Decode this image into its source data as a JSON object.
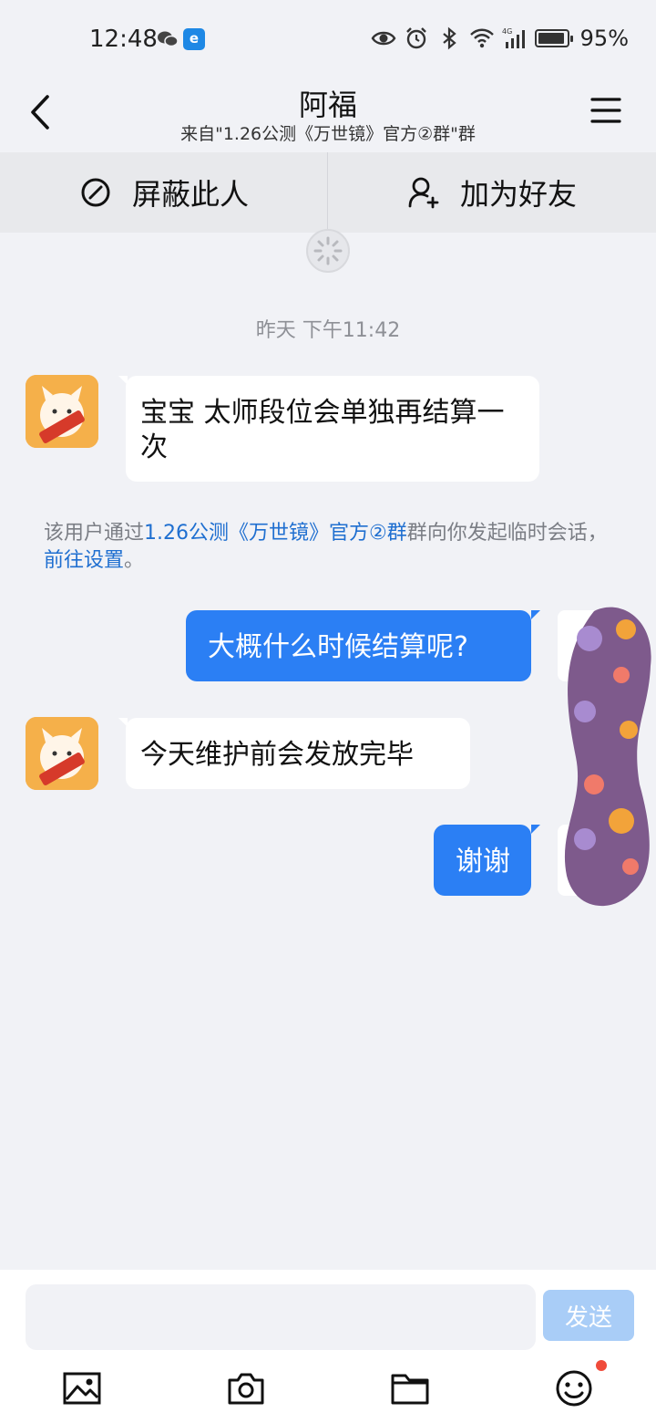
{
  "status_bar": {
    "time": "12:48",
    "app_badge": "e",
    "network": "4G",
    "battery_percent": "95%",
    "battery_level": 0.95
  },
  "header": {
    "title": "阿福",
    "subtitle": "来自\"1.26公测《万世镜》官方②群\"群"
  },
  "actions": {
    "block": "屏蔽此人",
    "add_friend": "加为好友"
  },
  "chat": {
    "timestamp": "昨天 下午11:42",
    "messages": [
      {
        "from": "other",
        "text": "宝宝 太师段位会单独再结算一次"
      },
      {
        "from": "me",
        "text": "大概什么时候结算呢?"
      },
      {
        "from": "other",
        "text": "今天维护前会发放完毕"
      },
      {
        "from": "me",
        "text": "谢谢"
      }
    ],
    "system_note": {
      "prefix": "该用户通过",
      "group_link": "1.26公测《万世镜》官方②群",
      "middle": "群向你发起临时会话，",
      "settings_link": "前往设置",
      "suffix": "。"
    }
  },
  "input": {
    "placeholder": "",
    "send_label": "发送"
  },
  "toolbar": {
    "icons": [
      "image-icon",
      "camera-icon",
      "folder-icon",
      "emoji-icon"
    ]
  },
  "colors": {
    "outgoing_bubble": "#2b7ff4",
    "link": "#1f6fd0",
    "send_disabled": "#a9cdf7",
    "notification_dot": "#f04b3a"
  }
}
